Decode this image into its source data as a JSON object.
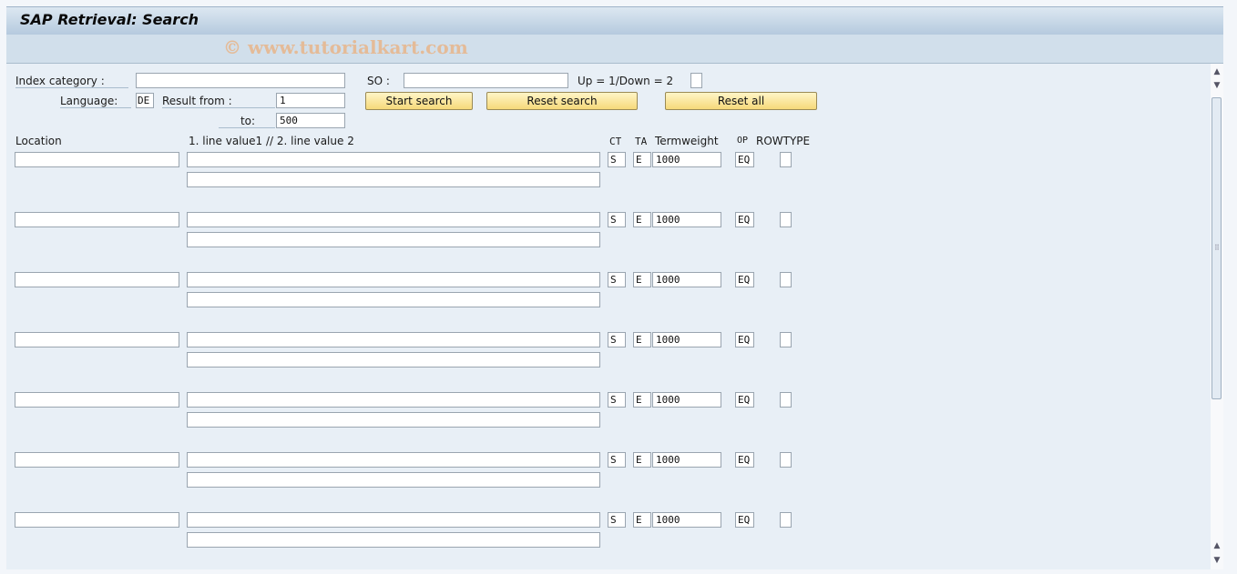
{
  "window": {
    "title": "SAP Retrieval: Search",
    "watermark": "© www.tutorialkart.com"
  },
  "form": {
    "index_category_label": "Index category  :",
    "index_category_value": "",
    "so_label": "SO :",
    "so_value": "",
    "updown_label": "Up = 1/Down = 2",
    "updown_value": "",
    "language_label": "Language:",
    "language_value": "DE",
    "result_from_label": "Result from :",
    "result_from_value": "1",
    "to_label": "to:",
    "to_value": "500"
  },
  "buttons": {
    "start_search": "Start search",
    "reset_search": "Reset search",
    "reset_all": "Reset all"
  },
  "table": {
    "headers": {
      "location": "Location",
      "line_values": "1. line value1 // 2. line value 2",
      "ct": "CT",
      "ta": "TA",
      "termweight": "Termweight",
      "op": "OP",
      "rowtype": "ROWTYPE"
    },
    "rows": [
      {
        "location": "",
        "line1": "",
        "line2": "",
        "ct": "S",
        "ta": "E",
        "termweight": "1000",
        "op": "EQ",
        "rowtype": ""
      },
      {
        "location": "",
        "line1": "",
        "line2": "",
        "ct": "S",
        "ta": "E",
        "termweight": "1000",
        "op": "EQ",
        "rowtype": ""
      },
      {
        "location": "",
        "line1": "",
        "line2": "",
        "ct": "S",
        "ta": "E",
        "termweight": "1000",
        "op": "EQ",
        "rowtype": ""
      },
      {
        "location": "",
        "line1": "",
        "line2": "",
        "ct": "S",
        "ta": "E",
        "termweight": "1000",
        "op": "EQ",
        "rowtype": ""
      },
      {
        "location": "",
        "line1": "",
        "line2": "",
        "ct": "S",
        "ta": "E",
        "termweight": "1000",
        "op": "EQ",
        "rowtype": ""
      },
      {
        "location": "",
        "line1": "",
        "line2": "",
        "ct": "S",
        "ta": "E",
        "termweight": "1000",
        "op": "EQ",
        "rowtype": ""
      },
      {
        "location": "",
        "line1": "",
        "line2": "",
        "ct": "S",
        "ta": "E",
        "termweight": "1000",
        "op": "EQ",
        "rowtype": ""
      }
    ]
  },
  "scrollbar": {
    "up_icon": "▲",
    "down_icon": "▼",
    "grip_icon": "⠿"
  }
}
